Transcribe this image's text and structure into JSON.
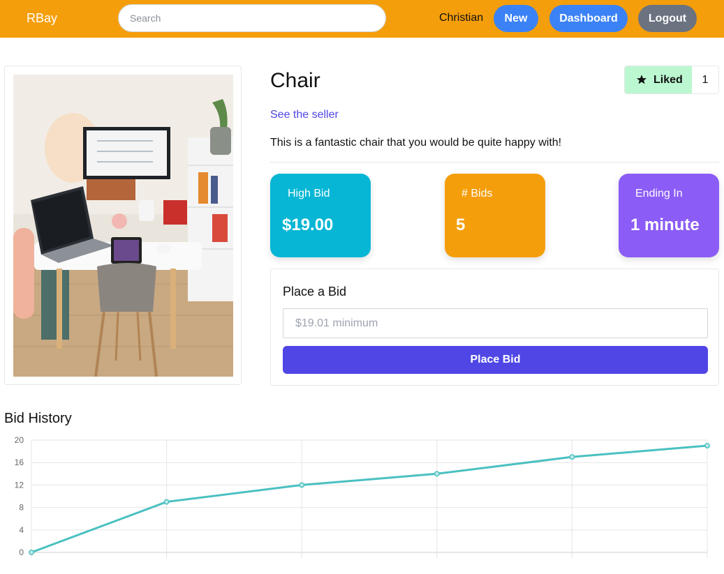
{
  "nav": {
    "brand": "RBay",
    "search_placeholder": "Search",
    "user": "Christian",
    "new_label": "New",
    "dashboard_label": "Dashboard",
    "logout_label": "Logout"
  },
  "item": {
    "title": "Chair",
    "seller_link": "See the seller",
    "description": "This is a fantastic chair that you would be quite happy with!",
    "liked_label": "Liked",
    "like_count": "1"
  },
  "stats": {
    "high_bid_label": "High Bid",
    "high_bid_value": "$19.00",
    "bids_label": "# Bids",
    "bids_value": "5",
    "ending_label": "Ending In",
    "ending_value": "1 minute"
  },
  "bid_form": {
    "title": "Place a Bid",
    "placeholder": "$19.01 minimum",
    "button": "Place Bid"
  },
  "history": {
    "title": "Bid History"
  },
  "colors": {
    "nav_bg": "#f59e0b",
    "primary": "#3b82f6",
    "accent": "#4f46e5",
    "high_bid": "#06b6d4",
    "bids": "#f59e0b",
    "ending": "#8b5cf6",
    "line": "#4bc0c0"
  },
  "chart_data": {
    "type": "line",
    "x": [
      0,
      1,
      2,
      3,
      4,
      5
    ],
    "values": [
      0,
      9,
      12,
      14,
      17,
      19
    ],
    "ylim": [
      0,
      20
    ],
    "yticks": [
      "0",
      "4",
      "8",
      "12",
      "16",
      "20"
    ],
    "grid": true,
    "xlabel": "",
    "ylabel": ""
  }
}
